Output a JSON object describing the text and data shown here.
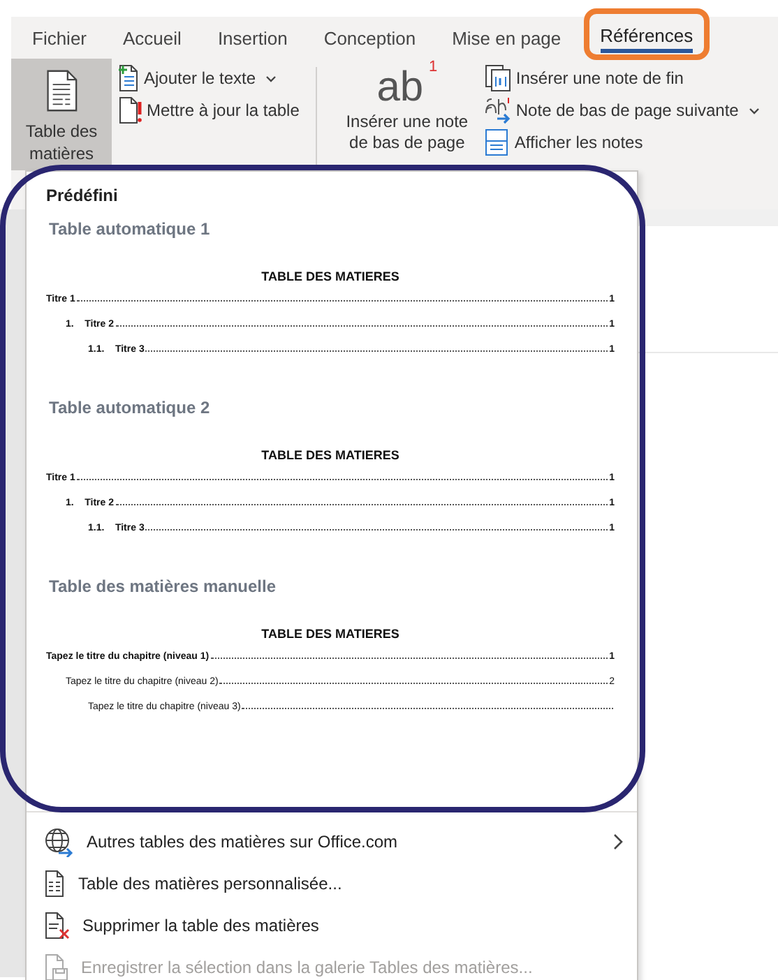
{
  "ribbon_tabs": [
    {
      "label": "Fichier",
      "selected": false,
      "annotated": false
    },
    {
      "label": "Accueil",
      "selected": false,
      "annotated": false
    },
    {
      "label": "Insertion",
      "selected": false,
      "annotated": false
    },
    {
      "label": "Conception",
      "selected": false,
      "annotated": false
    },
    {
      "label": "Mise en page",
      "selected": false,
      "annotated": false
    },
    {
      "label": "Références",
      "selected": true,
      "annotated": true
    }
  ],
  "toc_group": {
    "big_button": {
      "label": "Table des matières",
      "expanded": true
    },
    "items": [
      {
        "kind": "add-text",
        "label": "Ajouter le texte",
        "dropdown": true
      },
      {
        "kind": "update",
        "label": "Mettre à jour la table",
        "dropdown": false
      }
    ]
  },
  "notes_group": {
    "big_button": {
      "icon_text": "ab",
      "icon_mark": "1",
      "label": "Insérer une note de bas de page"
    },
    "items": [
      {
        "kind": "endnote",
        "label": "Insérer une note de fin",
        "dropdown": false
      },
      {
        "kind": "next",
        "label": "Note de bas de page suivante",
        "dropdown": true
      },
      {
        "kind": "show",
        "label": "Afficher les notes",
        "dropdown": false
      }
    ]
  },
  "menu": {
    "header": "Prédéfini",
    "annotated": true,
    "gallery": [
      {
        "title": "Table automatique 1",
        "preview_heading": "TABLE DES MATIERES",
        "entries": [
          {
            "text": "Titre 1",
            "page": "1",
            "bold": true,
            "children": [
              {
                "number": "1.",
                "text": "Titre 2",
                "page": "1",
                "bold": true,
                "children": [
                  {
                    "number": "1.1.",
                    "text": "Titre 3",
                    "page": "1",
                    "bold": true
                  }
                ]
              }
            ]
          }
        ]
      },
      {
        "title": "Table automatique 2",
        "preview_heading": "TABLE DES MATIERES",
        "entries": [
          {
            "text": "Titre 1",
            "page": "1",
            "bold": true,
            "children": [
              {
                "number": "1.",
                "text": "Titre 2",
                "page": "1",
                "bold": true,
                "children": [
                  {
                    "number": "1.1.",
                    "text": "Titre 3",
                    "page": "1",
                    "bold": true
                  }
                ]
              }
            ]
          }
        ]
      },
      {
        "title": "Table des matières manuelle",
        "preview_heading": "TABLE DES MATIERES",
        "entries": [
          {
            "text": "Tapez le titre du chapitre (niveau 1)",
            "page": "1",
            "bold": true,
            "children": [
              {
                "text": "Tapez le titre du chapitre (niveau 2)",
                "page": "2",
                "bold": false,
                "children": [
                  {
                    "text": "Tapez le titre du chapitre (niveau 3)",
                    "bold": false
                  }
                ]
              }
            ]
          }
        ]
      }
    ],
    "commands": [
      {
        "kind": "web",
        "label": "Autres tables des matières sur Office.com",
        "submenu": true,
        "disabled": false
      },
      {
        "kind": "custom",
        "label": "Table des matières personnalisée...",
        "submenu": false,
        "disabled": false
      },
      {
        "kind": "remove",
        "label": "Supprimer la table des matières",
        "submenu": false,
        "disabled": false
      },
      {
        "kind": "save",
        "label": "Enregistrer la sélection dans la galerie Tables des matières...",
        "submenu": false,
        "disabled": true
      }
    ]
  }
}
